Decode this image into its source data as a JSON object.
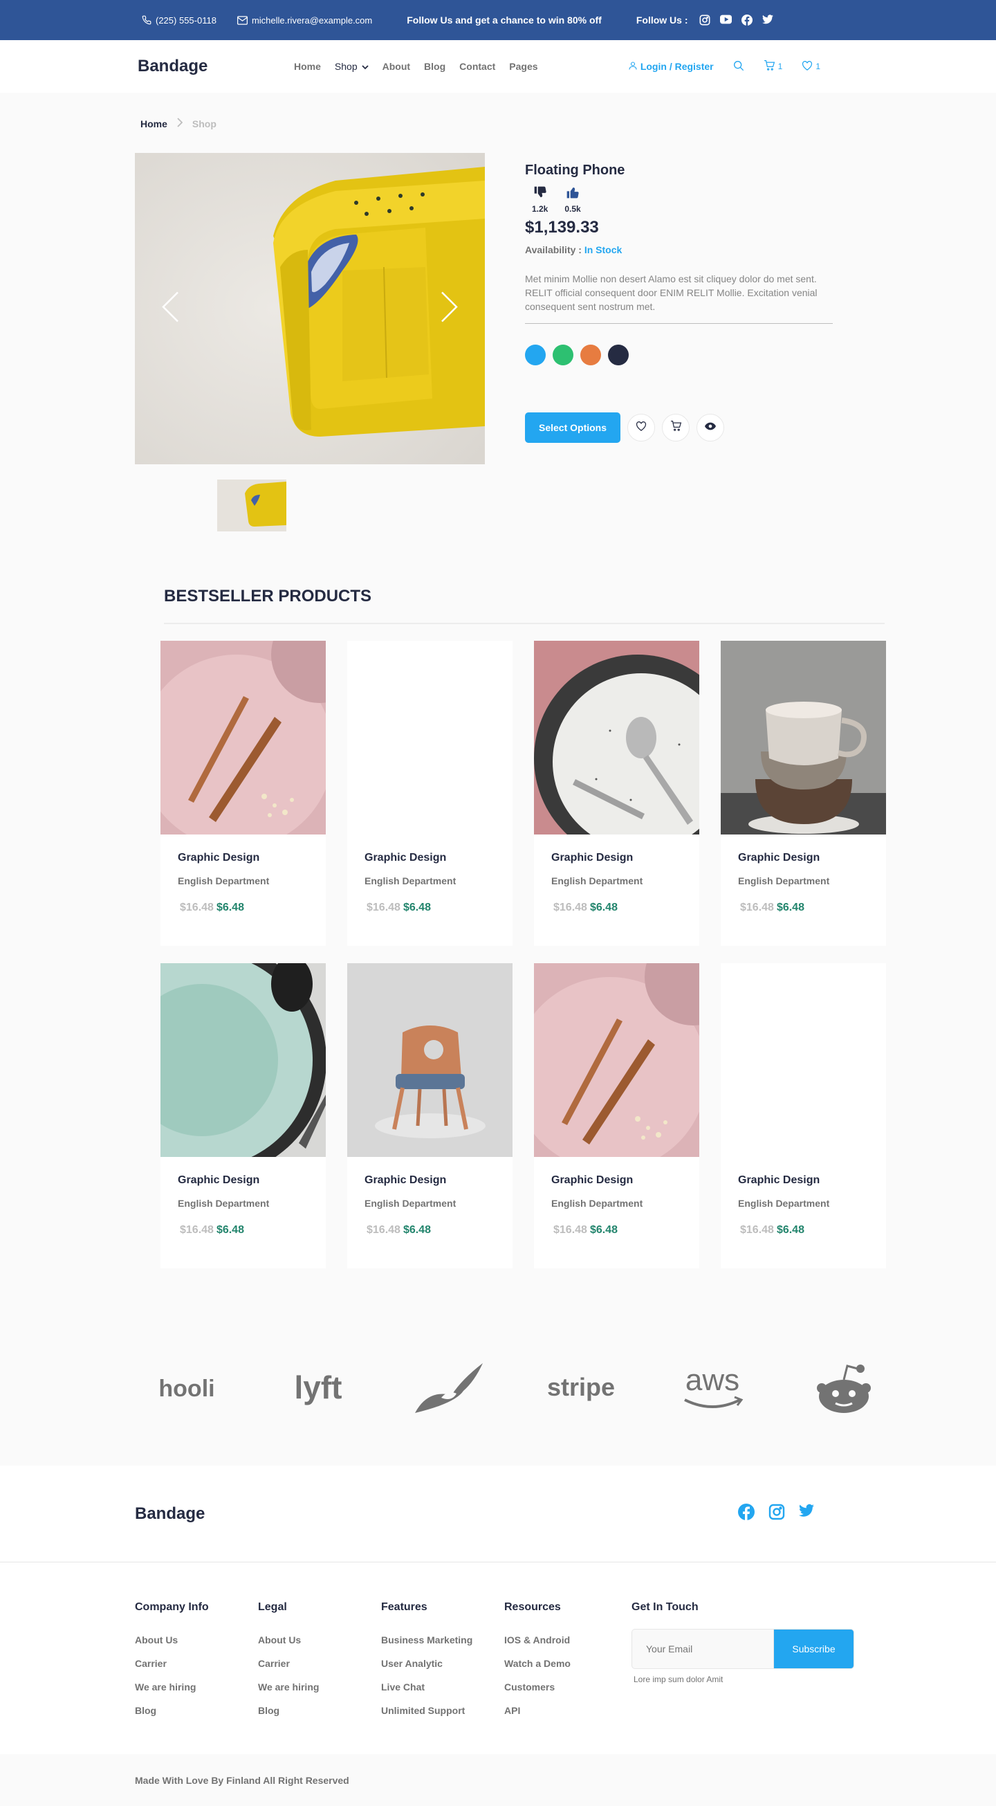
{
  "topbar": {
    "phone": "(225) 555-0118",
    "email": "michelle.rivera@example.com",
    "promo": "Follow Us  and get a chance to win 80% off",
    "follow_label": "Follow Us  :"
  },
  "header": {
    "brand": "Bandage",
    "nav": [
      "Home",
      "Shop",
      "About",
      "Blog",
      "Contact",
      "Pages"
    ],
    "login": "Login / Register",
    "cart_count": "1",
    "wishlist_count": "1"
  },
  "breadcrumb": {
    "home": "Home",
    "current": "Shop"
  },
  "product": {
    "title": "Floating Phone",
    "dislikes": "1.2k",
    "likes": "0.5k",
    "price": "$1,139.33",
    "availability_label": "Availability  :",
    "availability_value": "In Stock",
    "description": "Met minim Mollie non desert Alamo est sit cliquey dolor do met sent. RELIT official consequent door ENIM RELIT Mollie. Excitation venial consequent sent nostrum met.",
    "colors": [
      "#23A6F0",
      "#2DC071",
      "#E77C40",
      "#252B42"
    ],
    "select_label": "Select Options"
  },
  "bestseller": {
    "title": "BESTSELLER PRODUCTS",
    "products": [
      {
        "name": "Graphic Design",
        "dept": "English Department",
        "old": "$16.48",
        "new": "$6.48"
      },
      {
        "name": "Graphic Design",
        "dept": "English Department",
        "old": "$16.48",
        "new": "$6.48"
      },
      {
        "name": "Graphic Design",
        "dept": "English Department",
        "old": "$16.48",
        "new": "$6.48"
      },
      {
        "name": "Graphic Design",
        "dept": "English Department",
        "old": "$16.48",
        "new": "$6.48"
      },
      {
        "name": "Graphic Design",
        "dept": "English Department",
        "old": "$16.48",
        "new": "$6.48"
      },
      {
        "name": "Graphic Design",
        "dept": "English Department",
        "old": "$16.48",
        "new": "$6.48"
      },
      {
        "name": "Graphic Design",
        "dept": "English Department",
        "old": "$16.48",
        "new": "$6.48"
      },
      {
        "name": "Graphic Design",
        "dept": "English Department",
        "old": "$16.48",
        "new": "$6.48"
      }
    ]
  },
  "logos": [
    "hooli",
    "lyft",
    "stripe",
    "aws"
  ],
  "footer": {
    "brand": "Bandage",
    "columns": [
      {
        "title": "Company Info",
        "links": [
          "About Us",
          "Carrier",
          "We are hiring",
          "Blog"
        ]
      },
      {
        "title": "Legal",
        "links": [
          "About Us",
          "Carrier",
          "We are hiring",
          "Blog"
        ]
      },
      {
        "title": "Features",
        "links": [
          "Business Marketing",
          "User Analytic",
          "Live Chat",
          "Unlimited Support"
        ]
      },
      {
        "title": "Resources",
        "links": [
          "IOS & Android",
          "Watch a Demo",
          "Customers",
          "API"
        ]
      }
    ],
    "touch_title": "Get In Touch",
    "email_placeholder": "Your Email",
    "subscribe_label": "Subscribe",
    "note": "Lore imp sum dolor Amit",
    "copyright": "Made With Love By Finland All Right Reserved"
  }
}
